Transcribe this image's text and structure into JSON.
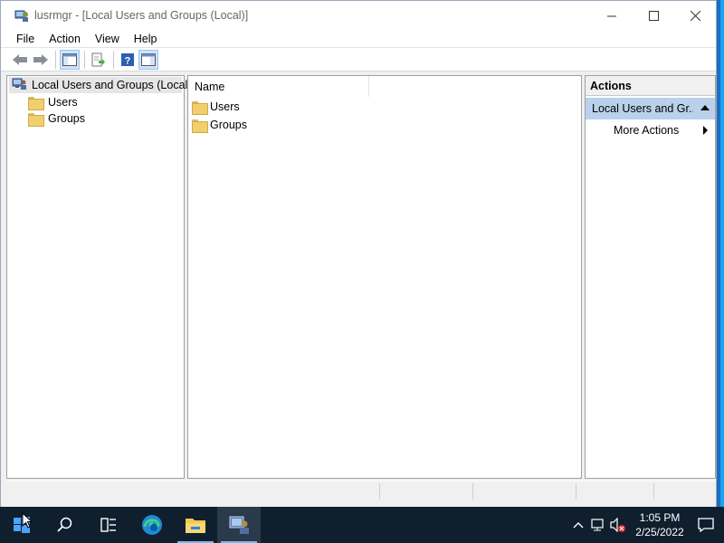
{
  "window": {
    "title": "lusrmgr - [Local Users and Groups (Local)]",
    "minimize_glyph": "—",
    "maximize_glyph": "☐",
    "close_glyph": "✕"
  },
  "menu": {
    "items": [
      "File",
      "Action",
      "View",
      "Help"
    ]
  },
  "toolbar": {
    "buttons": [
      "back-arrow-icon",
      "forward-arrow-icon",
      "show-hide-console-tree-icon",
      "export-list-icon",
      "help-icon",
      "show-hide-action-pane-icon"
    ]
  },
  "tree": {
    "root_label": "Local Users and Groups (Local)",
    "children": [
      "Users",
      "Groups"
    ]
  },
  "list": {
    "column_name": "Name",
    "rows": [
      "Users",
      "Groups"
    ]
  },
  "actions": {
    "header": "Actions",
    "group_label": "Local Users and Gr...",
    "more_actions": "More Actions"
  },
  "taskbar": {
    "apps": [
      "start-icon",
      "search-icon",
      "task-view-icon",
      "edge-icon",
      "file-explorer-icon",
      "lusrmgr-icon"
    ],
    "time": "1:05 PM",
    "date": "2/25/2022"
  },
  "colors": {
    "selection": "#b9d1ea",
    "taskbar": "#101f2e",
    "desktop": "#1a6fc4"
  }
}
